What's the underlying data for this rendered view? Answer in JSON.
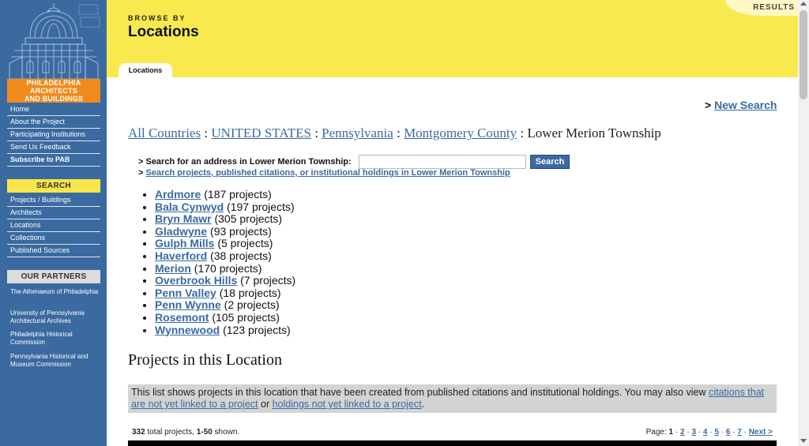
{
  "sidebar": {
    "logo_label_line1": "PHILADELPHIA ARCHITECTS",
    "logo_label_line2": "AND BUILDINGS",
    "nav_items": [
      "Home",
      "About the Project",
      "Participating Institutions",
      "Send Us Feedback",
      "Subscribe to PAB"
    ],
    "search_heading": "SEARCH",
    "search_items": [
      "Projects / Buildings",
      "Architects",
      "Locations",
      "Collections",
      "Published Sources"
    ],
    "partners_heading": "OUR PARTNERS",
    "partners": [
      "The Athenaeum of Philadelphia",
      "University of Pennsylvania Architectural Archives",
      "Philadelphia Historical Commission",
      "Pennsylvania Historical and Museum Commission"
    ]
  },
  "header": {
    "browse_by": "BROWSE BY",
    "title": "Locations",
    "results_tab": "RESULTS",
    "active_tab": "Locations"
  },
  "main": {
    "new_search_prefix": ">",
    "new_search": "New Search",
    "breadcrumb": {
      "links": [
        "All Countries",
        "UNITED STATES",
        "Pennsylvania",
        "Montgomery County"
      ],
      "separator": ":",
      "current": "Lower Merion Township"
    },
    "search_label": "> Search for an address in Lower Merion Township:",
    "search_value": "",
    "search_button": "Search",
    "search_projects_prefix": ">",
    "search_projects_link": "Search projects, published citations, or institutional holdings in Lower Merion Township",
    "places": [
      {
        "name": "Ardmore",
        "count": "(187 projects)"
      },
      {
        "name": "Bala Cynwyd",
        "count": "(197 projects)"
      },
      {
        "name": "Bryn Mawr",
        "count": "(305 projects)"
      },
      {
        "name": "Gladwyne",
        "count": "(93 projects)"
      },
      {
        "name": "Gulph Mills",
        "count": "(5 projects)"
      },
      {
        "name": "Haverford",
        "count": "(38 projects)"
      },
      {
        "name": "Merion",
        "count": "(170 projects)"
      },
      {
        "name": "Overbrook Hills",
        "count": "(7 projects)"
      },
      {
        "name": "Penn Valley",
        "count": "(18 projects)"
      },
      {
        "name": "Penn Wynne",
        "count": "(2 projects)"
      },
      {
        "name": "Rosemont",
        "count": "(105 projects)"
      },
      {
        "name": "Wynnewood",
        "count": "(123 projects)"
      }
    ],
    "projects_heading": "Projects in this Location",
    "notice": {
      "text_before": "This list shows projects in this location that have been created from published citations and institutional holdings. You may also view ",
      "link1": "citations that are not yet linked to a project",
      "text_middle": " or ",
      "link2": "holdings not yet linked to a project",
      "text_after": "."
    },
    "total_count": "332",
    "total_label": "total projects,",
    "shown_range": "1-50",
    "shown_label": "shown.",
    "pager_label": "Page:",
    "current_page": "1",
    "pages": [
      "2",
      "3",
      "4",
      "5",
      "6",
      "7"
    ],
    "next_label": "Next >"
  }
}
